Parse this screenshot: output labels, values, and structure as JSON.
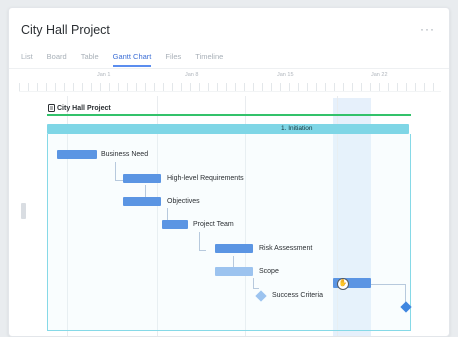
{
  "header": {
    "title": "City Hall Project",
    "more_icon": "···"
  },
  "tabs": [
    {
      "label": "List",
      "active": false
    },
    {
      "label": "Board",
      "active": false
    },
    {
      "label": "Table",
      "active": false
    },
    {
      "label": "Gantt Chart",
      "active": true
    },
    {
      "label": "Files",
      "active": false
    },
    {
      "label": "Timeline",
      "active": false
    }
  ],
  "timeline": {
    "dates": [
      "Jan 1",
      "Jan 8",
      "Jan 15",
      "Jan 22"
    ]
  },
  "project": {
    "label": "City Hall Project",
    "icon": "project-icon"
  },
  "phase": {
    "label": "1. Initiation"
  },
  "tasks": [
    {
      "label": "Business Need"
    },
    {
      "label": "High-level Requirements"
    },
    {
      "label": "Objectives"
    },
    {
      "label": "Project Team"
    },
    {
      "label": "Risk Assessment"
    },
    {
      "label": "Scope"
    },
    {
      "label": "Success Criteria"
    }
  ],
  "colors": {
    "task": "#5b95e3",
    "task_light": "#9cc3ef",
    "phase": "#7fd6e6",
    "project_line": "#32c26b",
    "highlight": "#e6f0fb",
    "accent": "#3d6fd6"
  }
}
